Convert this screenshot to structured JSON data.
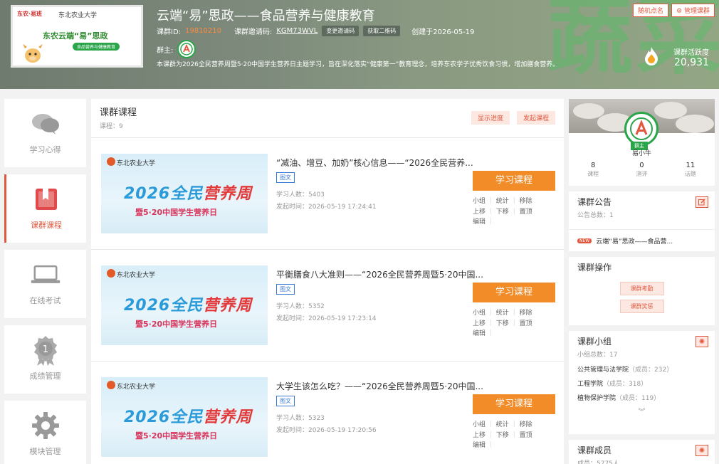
{
  "header": {
    "cover": {
      "logo_left": "东农·易班",
      "logo_right": "东北农业大学",
      "title": "东农云端“易”思政",
      "pill": "食品营养与健康教育"
    },
    "course_title": "云端“易”思政——食品营养与健康教育",
    "id_label": "课群ID:",
    "id_value": "19810210",
    "invite_label": "课群邀请码:",
    "invite_code": "KGM73WVL",
    "change_code_btn": "变更邀请码",
    "qr_btn": "获取二维码",
    "created": "创建于2026-05-19",
    "owner_label": "群主:",
    "description": "本课群为2026全民营养周暨5·20中国学生营养日主题学习，旨在深化落实“健康第一”教育理念，培养东农学子优秀饮食习惯，增加膳食营养。",
    "random_call": "随机点名",
    "manage": "管理课群",
    "activity_label": "课群活跃度",
    "activity_value": "20,931",
    "bg_deco": "蔬菜"
  },
  "sidebar": {
    "items": [
      {
        "label": "学习心得",
        "icon": "chat-bubbles-icon",
        "active": false
      },
      {
        "label": "课群课程",
        "icon": "bookmark-book-icon",
        "active": true
      },
      {
        "label": "在线考试",
        "icon": "laptop-icon",
        "active": false
      },
      {
        "label": "成绩管理",
        "icon": "medal-icon",
        "active": false
      },
      {
        "label": "模块管理",
        "icon": "gear-icon",
        "active": false
      }
    ]
  },
  "main": {
    "title": "课群课程",
    "count_label": "课程：9",
    "progress_btn": "显示进度",
    "create_btn": "发起课程",
    "courses": [
      {
        "name": "“减油、增豆、加奶”核心信息——“2026全民营养...",
        "type": "图文",
        "learners": "学习人数：5403",
        "time": "发起时间：2026-05-19 17:24:41"
      },
      {
        "name": "平衡膳食八大准则——“2026全民营养周暨5·20中国...",
        "type": "图文",
        "learners": "学习人数：5352",
        "time": "发起时间：2026-05-19 17:23:14"
      },
      {
        "name": "大学生该怎么吃？——“2026全民营养周暨5·20中国...",
        "type": "图文",
        "learners": "学习人数：5323",
        "time": "发起时间：2026-05-19 17:20:56"
      }
    ],
    "thumb": {
      "uni": "东北农业大学",
      "big_a": "2026全民",
      "big_b": "营养周",
      "sub": "暨5·20中国学生营养日"
    },
    "learn_btn": "学习课程",
    "ops": {
      "group": "小组",
      "stats": "统计",
      "remove": "移除",
      "up": "上移",
      "down": "下移",
      "top": "置顶",
      "edit": "编辑"
    }
  },
  "right": {
    "user": {
      "role": "群主",
      "name": "易小牛",
      "stats": [
        {
          "value": "8",
          "label": "课程"
        },
        {
          "value": "0",
          "label": "测评"
        },
        {
          "value": "11",
          "label": "话题"
        }
      ]
    },
    "notice": {
      "title": "课群公告",
      "count": "公告总数：1",
      "new_tag": "NEW",
      "item": "云端“易”思政——食品营..."
    },
    "ops": {
      "title": "课群操作",
      "attendance": "课群考勤",
      "reward": "课群奖惩"
    },
    "groups": {
      "title": "课群小组",
      "count": "小组总数：17",
      "items": [
        {
          "name": "公共管理与法学院",
          "members": "（成员：232）"
        },
        {
          "name": "工程学院",
          "members": "（成员：318）"
        },
        {
          "name": "植物保护学院",
          "members": "（成员：119）"
        }
      ]
    },
    "members": {
      "title": "课群成员",
      "count": "成员：5775人"
    }
  }
}
